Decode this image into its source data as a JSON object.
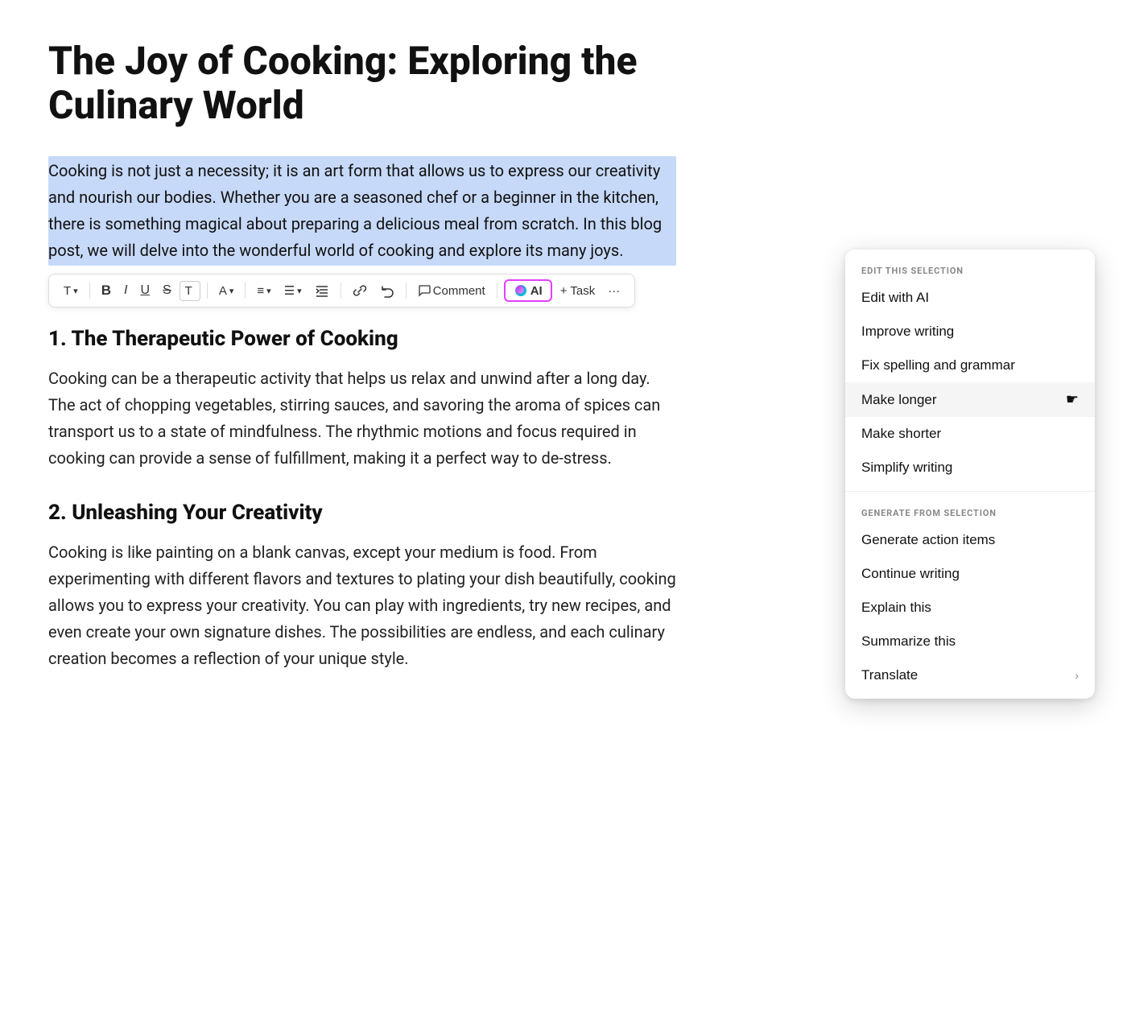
{
  "document": {
    "title": "The Joy of Cooking: Exploring the Culinary World",
    "selected_paragraph": "Cooking is not just a necessity; it is an art form that allows us to express our creativity and nourish our bodies. Whether you are a seasoned chef or a beginner in the kitchen, there is something magical about preparing a delicious meal from scratch. In this blog post, we will delve into the wonderful world of cooking and explore its many joys.",
    "sections": [
      {
        "number": "1.",
        "heading": "The Therapeutic Power of Cooking",
        "paragraph": "Cooking can be a therapeutic activity that helps us relax and unwind after a long day. The act of chopping vegetables, stirring sauces, and savoring the aroma of spices can transport us to a state of mindfulness. The rhythmic motions and focus required in cooking can provide a sense of fulfillment, making it a perfect way to de-stress."
      },
      {
        "number": "2.",
        "heading": "Unleashing Your Creativity",
        "paragraph": "Cooking is like painting on a blank canvas, except your medium is food. From experimenting with different flavors and textures to plating your dish beautifully, cooking allows you to express your creativity. You can play with ingredients, try new recipes, and even create your own signature dishes. The possibilities are endless, and each culinary creation becomes a reflection of your unique style."
      }
    ]
  },
  "toolbar": {
    "items": [
      {
        "id": "text",
        "label": "T",
        "has_dropdown": true
      },
      {
        "id": "bold",
        "label": "B"
      },
      {
        "id": "italic",
        "label": "I"
      },
      {
        "id": "underline",
        "label": "U"
      },
      {
        "id": "strikethrough",
        "label": "S"
      },
      {
        "id": "highlight",
        "label": "T̲"
      },
      {
        "id": "font-color",
        "label": "A",
        "has_dropdown": true
      },
      {
        "id": "align",
        "label": "≡",
        "has_dropdown": true
      },
      {
        "id": "list",
        "label": "☰",
        "has_dropdown": true
      },
      {
        "id": "indent",
        "label": "⇥"
      },
      {
        "id": "link",
        "label": "🔗"
      },
      {
        "id": "undo",
        "label": "↺"
      },
      {
        "id": "comment",
        "label": "Comment"
      },
      {
        "id": "ai",
        "label": "AI"
      },
      {
        "id": "task",
        "label": "+ Task"
      },
      {
        "id": "more",
        "label": "···"
      }
    ]
  },
  "ai_dropdown": {
    "edit_section_label": "EDIT THIS SELECTION",
    "generate_section_label": "GENERATE FROM SELECTION",
    "edit_items": [
      {
        "id": "edit-with-ai",
        "label": "Edit with AI",
        "hovered": false
      },
      {
        "id": "improve-writing",
        "label": "Improve writing",
        "hovered": false
      },
      {
        "id": "fix-spelling",
        "label": "Fix spelling and grammar",
        "hovered": false
      },
      {
        "id": "make-longer",
        "label": "Make longer",
        "hovered": true
      },
      {
        "id": "make-shorter",
        "label": "Make shorter",
        "hovered": false
      },
      {
        "id": "simplify-writing",
        "label": "Simplify writing",
        "hovered": false
      }
    ],
    "generate_items": [
      {
        "id": "generate-action-items",
        "label": "Generate action items",
        "hovered": false
      },
      {
        "id": "continue-writing",
        "label": "Continue writing",
        "hovered": false
      },
      {
        "id": "explain-this",
        "label": "Explain this",
        "hovered": false
      },
      {
        "id": "summarize-this",
        "label": "Summarize this",
        "hovered": false
      },
      {
        "id": "translate",
        "label": "Translate",
        "has_chevron": true,
        "hovered": false
      }
    ]
  }
}
